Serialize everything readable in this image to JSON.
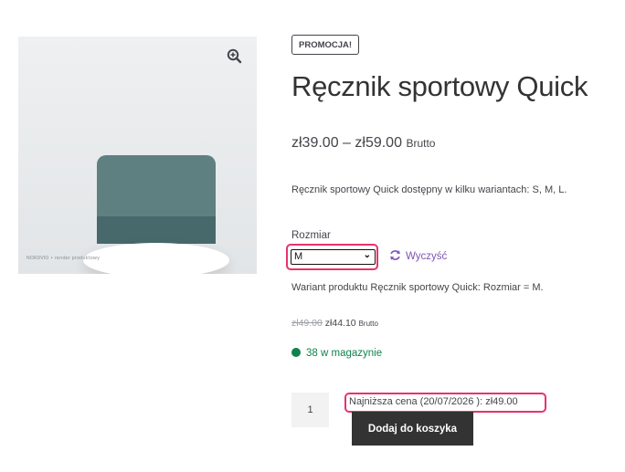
{
  "product": {
    "badge": "PROMOCJA!",
    "title": "Ręcznik sportowy Quick",
    "price_range": "zł39.00 – zł59.00",
    "price_suffix": "Brutto",
    "description": "Ręcznik sportowy Quick dostępny w kilku wariantach: S, M, L.",
    "image_watermark": "NORDVIO • render produktowy"
  },
  "variation": {
    "attribute_label": "Rozmiar",
    "selected_value": "M",
    "reset_label": "Wyczyść",
    "variant_description": "Wariant produktu Ręcznik sportowy Quick: Rozmiar = M.",
    "old_price": "zł49.00",
    "new_price": "zł44.10",
    "price_suffix": "Brutto",
    "stock": "38 w magazynie",
    "lowest_price": "Najniższa cena (20/07/2026 ): zł49.00"
  },
  "cart": {
    "quantity": "1",
    "add_button": "Dodaj do koszyka"
  },
  "icons": {
    "zoom": "magnifier-plus-icon",
    "reset": "refresh-icon",
    "stock": "in-stock-dot-icon",
    "dropdown": "chevron-down-icon"
  },
  "colors": {
    "highlight": "#e8336b",
    "link": "#7f54b3",
    "stock": "#0f834d",
    "button": "#333333"
  }
}
